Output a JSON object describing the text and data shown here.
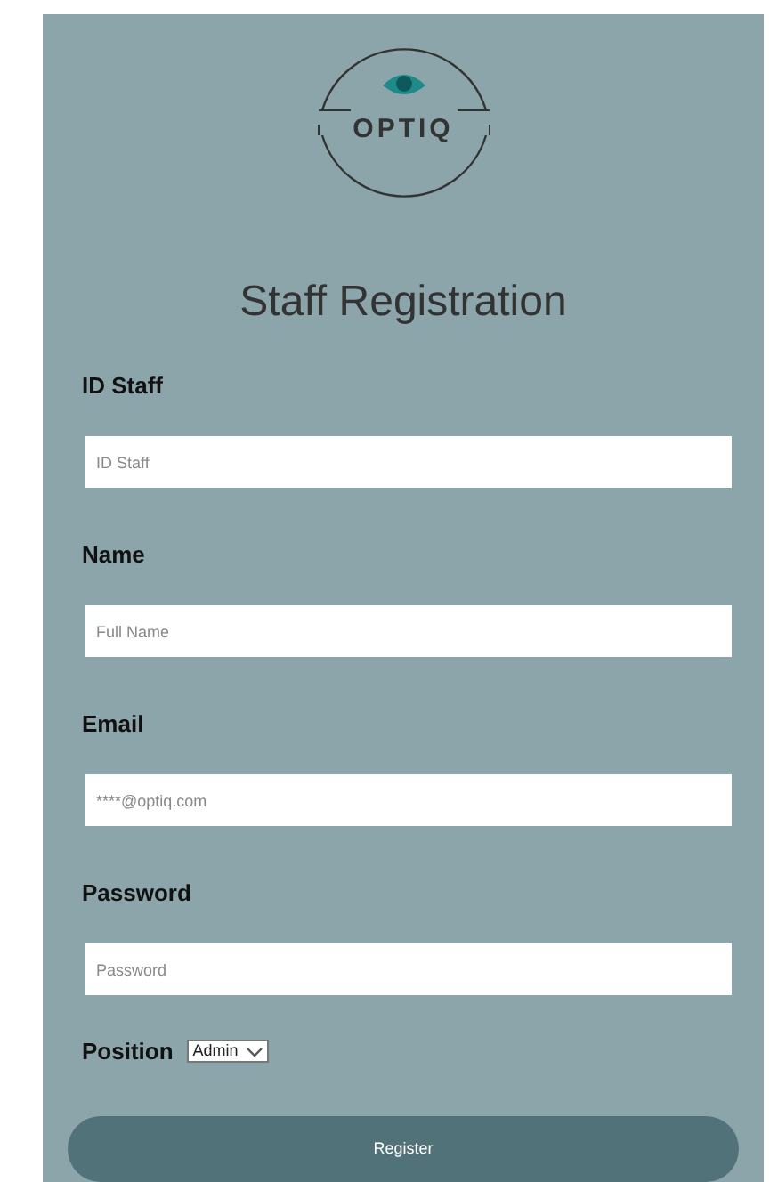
{
  "logo": {
    "text": "OPTIQ"
  },
  "title": "Staff Registration",
  "fields": [
    {
      "label": "ID Staff",
      "placeholder": "ID Staff"
    },
    {
      "label": "Name",
      "placeholder": "Full Name"
    },
    {
      "label": "Email",
      "placeholder": "****@optiq.com"
    },
    {
      "label": "Password",
      "placeholder": "Password"
    }
  ],
  "position": {
    "label": "Position",
    "value": "Admin"
  },
  "button": "Register"
}
